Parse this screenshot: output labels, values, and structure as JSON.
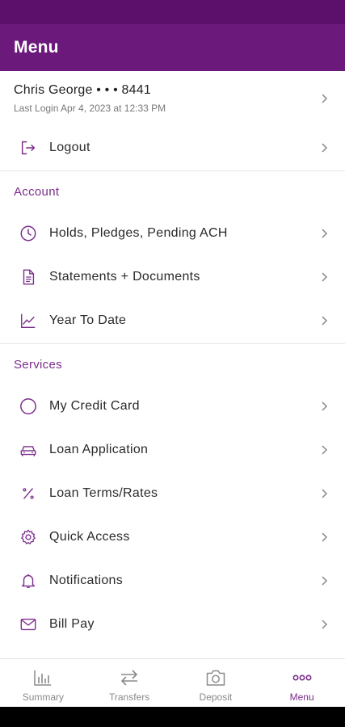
{
  "header": {
    "title": "Menu"
  },
  "user": {
    "name": "Chris George • • • 8441",
    "last_login": "Last Login Apr 4, 2023 at 12:33 PM"
  },
  "logout": {
    "label": "Logout"
  },
  "account": {
    "title": "Account",
    "items": [
      {
        "label": "Holds, Pledges, Pending ACH",
        "icon": "clock-icon"
      },
      {
        "label": "Statements + Documents",
        "icon": "document-icon"
      },
      {
        "label": "Year To Date",
        "icon": "line-chart-icon"
      }
    ]
  },
  "services": {
    "title": "Services",
    "items": [
      {
        "label": "My Credit Card",
        "icon": "circle-icon"
      },
      {
        "label": "Loan Application",
        "icon": "car-icon"
      },
      {
        "label": "Loan Terms/Rates",
        "icon": "percent-icon"
      },
      {
        "label": "Quick Access",
        "icon": "gear-icon"
      },
      {
        "label": "Notifications",
        "icon": "bell-icon"
      },
      {
        "label": "Bill Pay",
        "icon": "mail-icon"
      }
    ]
  },
  "tabs": [
    {
      "label": "Summary",
      "icon": "bar-chart-icon",
      "active": false
    },
    {
      "label": "Transfers",
      "icon": "transfer-arrows-icon",
      "active": false
    },
    {
      "label": "Deposit",
      "icon": "camera-icon",
      "active": false
    },
    {
      "label": "Menu",
      "icon": "more-dots-icon",
      "active": true
    }
  ],
  "colors": {
    "brand": "#6b1a7c",
    "accent": "#7b2d8b"
  }
}
